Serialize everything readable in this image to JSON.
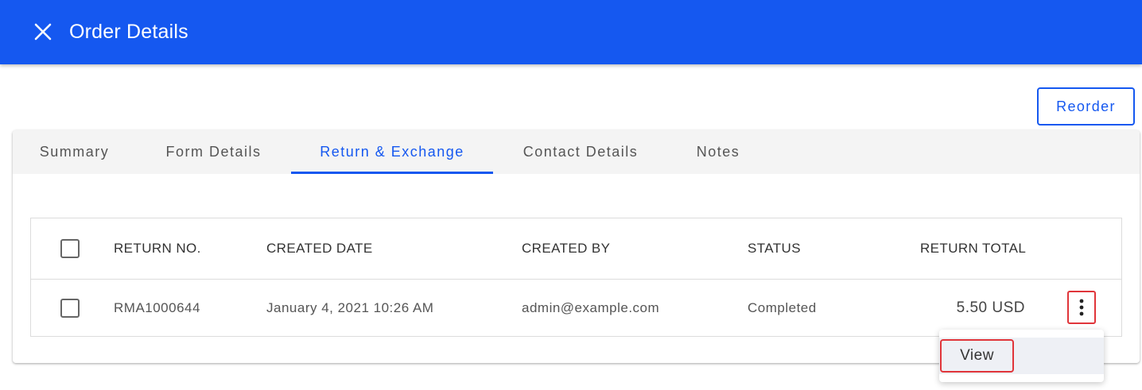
{
  "header": {
    "title": "Order Details",
    "close_icon": "close-icon"
  },
  "actions": {
    "reorder_label": "Reorder"
  },
  "tabs": [
    {
      "label": "Summary",
      "active": false
    },
    {
      "label": "Form Details",
      "active": false
    },
    {
      "label": "Return & Exchange",
      "active": true
    },
    {
      "label": "Contact Details",
      "active": false
    },
    {
      "label": "Notes",
      "active": false
    }
  ],
  "table": {
    "columns": [
      "RETURN NO.",
      "CREATED DATE",
      "CREATED BY",
      "STATUS",
      "RETURN TOTAL"
    ],
    "rows": [
      {
        "return_no": "RMA1000644",
        "created_date": "January 4, 2021 10:26 AM",
        "created_by": "admin@example.com",
        "status": "Completed",
        "return_total": "5.50 USD"
      }
    ]
  },
  "row_menu": {
    "items": [
      "View"
    ]
  },
  "colors": {
    "primary": "#1558f0",
    "highlight": "#e0353a"
  }
}
